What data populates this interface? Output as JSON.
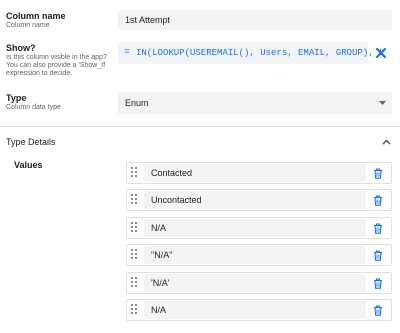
{
  "column_name": {
    "title": "Column name",
    "subtitle": "Column name",
    "value": "1st Attempt"
  },
  "show": {
    "title": "Show?",
    "subtitle_lines": [
      "Is this column visible in the app?",
      "You can also provide a 'Show_If",
      "expression to decide."
    ],
    "eq_sign": "=",
    "formula": "IN(LOOKUP(USEREMAIL(), Users, EMAIL, GROUP), L",
    "clear_icon": "close-icon"
  },
  "type": {
    "title": "Type",
    "subtitle": "Column data type",
    "value": "Enum",
    "dropdown_icon": "caret-down-icon"
  },
  "type_details": {
    "title": "Type Details",
    "collapse_icon": "chevron-up-icon"
  },
  "values": {
    "title": "Values",
    "items": [
      "Contacted",
      "Uncontacted",
      "N/A",
      "\"N/A\"",
      "'N/A'",
      "N/A"
    ]
  },
  "colors": {
    "accent": "#1a73e8",
    "field_bg": "#f1f3f4",
    "divider": "#e0e0e0"
  }
}
